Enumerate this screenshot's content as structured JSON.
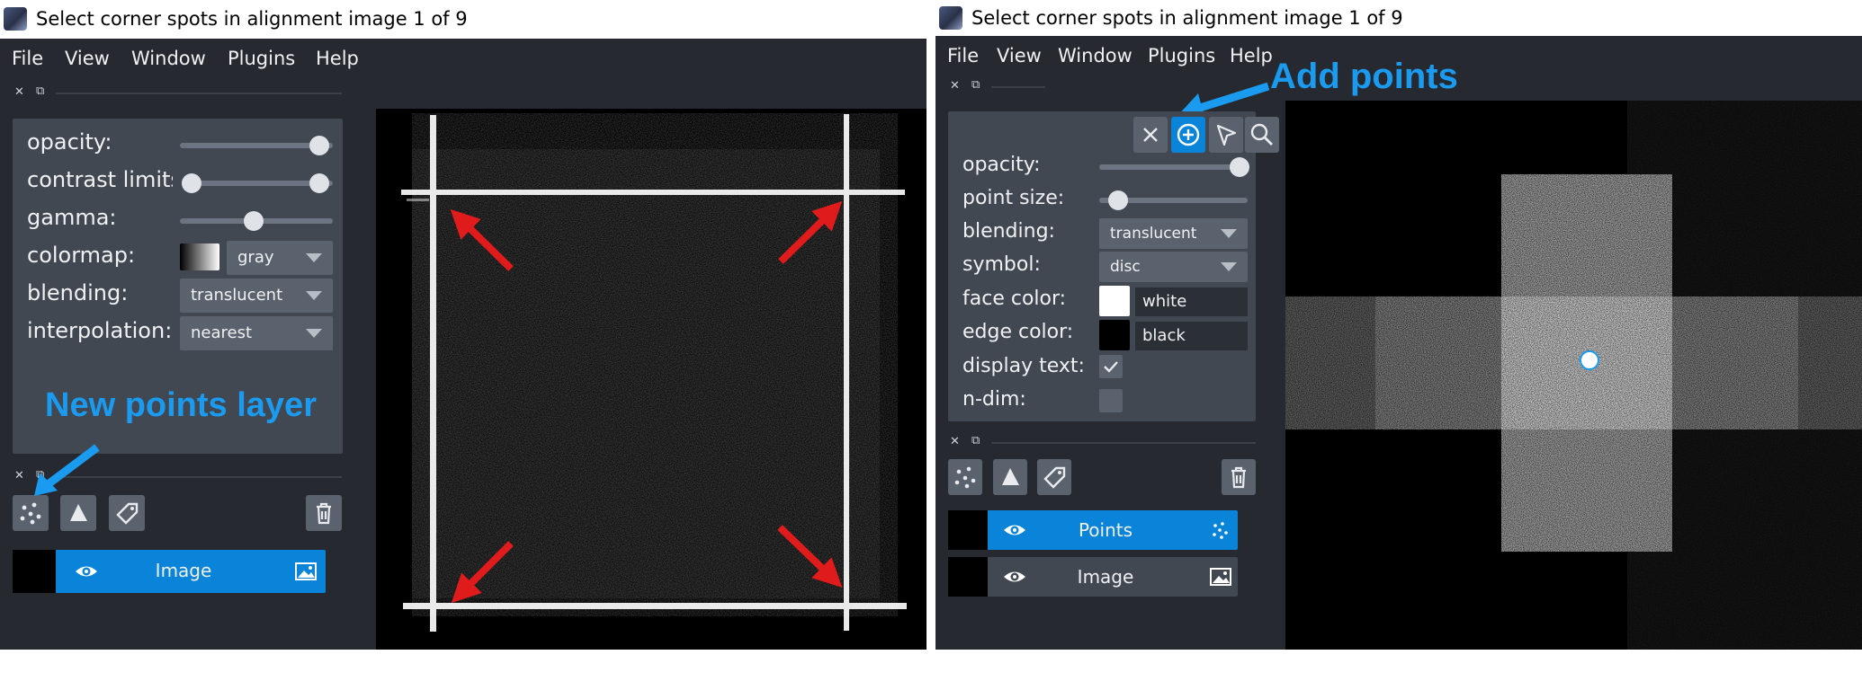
{
  "window_title": "Select corner spots in alignment image 1 of 9",
  "menu": [
    "File",
    "View",
    "Window",
    "Plugins",
    "Help"
  ],
  "left": {
    "controls": {
      "opacity_label": "opacity:",
      "contrast_label": "contrast limits",
      "gamma_label": "gamma:",
      "colormap_label": "colormap:",
      "colormap_value": "gray",
      "blending_label": "blending:",
      "blending_value": "translucent",
      "interpolation_label": "interpolation:",
      "interpolation_value": "nearest"
    },
    "annotation": "New points layer",
    "layer_name": "Image"
  },
  "right": {
    "annotation": "Add points",
    "controls": {
      "opacity_label": "opacity:",
      "point_size_label": "point size:",
      "blending_label": "blending:",
      "blending_value": "translucent",
      "symbol_label": "symbol:",
      "symbol_value": "disc",
      "face_color_label": "face color:",
      "face_color_value": "white",
      "edge_color_label": "edge color:",
      "edge_color_value": "black",
      "display_text_label": "display text:",
      "ndim_label": "n-dim:"
    },
    "layers": [
      {
        "name": "Points",
        "selected": true
      },
      {
        "name": "Image",
        "selected": false
      }
    ]
  },
  "colors": {
    "accent": "#0a84d8",
    "annotation": "#1a9bf0",
    "arrow_red": "#e01b1b",
    "background": "#262930",
    "panel": "#414851"
  }
}
